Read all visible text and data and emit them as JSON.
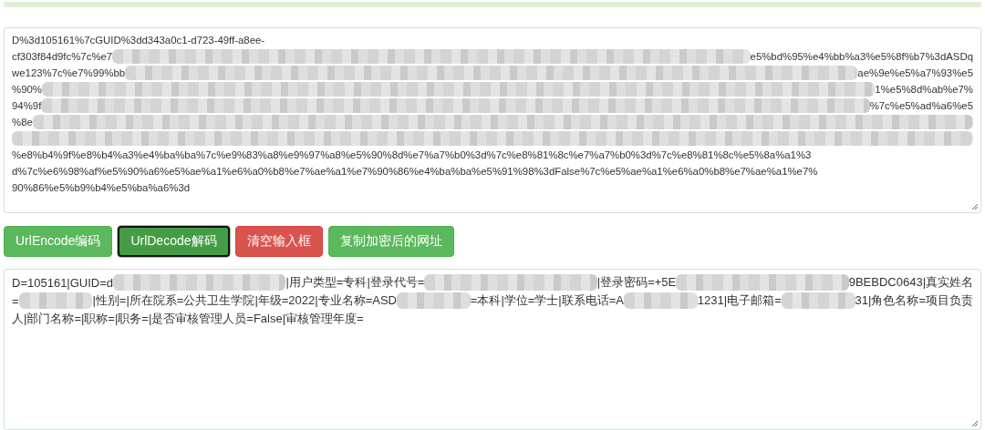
{
  "input_box": {
    "lines": [
      [
        {
          "kind": "text",
          "text": "D%3d105161%7cGUID%3dd343a0c1-d723-49ff-a8ee-"
        }
      ],
      [
        {
          "kind": "text",
          "text": "cf303f84d9fc%7c%e7"
        },
        {
          "kind": "redacted"
        },
        {
          "kind": "text",
          "text": "e5%bd%95%e4%bb%a3%e5%8f%b7%3dASDq"
        }
      ],
      [
        {
          "kind": "text",
          "text": "we123%7c%e7%99%bb"
        },
        {
          "kind": "redacted"
        },
        {
          "kind": "text",
          "text": "ae%9e%e5%a7%93%e5"
        }
      ],
      [
        {
          "kind": "text",
          "text": "%90%"
        },
        {
          "kind": "redacted"
        },
        {
          "kind": "text",
          "text": "1%e5%8d%ab%e7%"
        }
      ],
      [
        {
          "kind": "text",
          "text": "94%9f"
        },
        {
          "kind": "redacted"
        },
        {
          "kind": "text",
          "text": "%7c%e5%ad%a6%e5"
        }
      ],
      [
        {
          "kind": "text",
          "text": "%8e"
        },
        {
          "kind": "redacted"
        }
      ],
      [
        {
          "kind": "redacted"
        }
      ],
      [
        {
          "kind": "text",
          "text": "%e8%b4%9f%e8%b4%a3%e4%ba%ba%7c%e9%83%a8%e9%97%a8%e5%90%8d%e7%a7%b0%3d%7c%e8%81%8c%e7%a7%b0%3d%7c%e8%81%8c%e5%8a%a1%3"
        }
      ],
      [
        {
          "kind": "text",
          "text": "d%7c%e6%98%af%e5%90%a6%e5%ae%a1%e6%a0%b8%e7%ae%a1%e7%90%86%e4%ba%ba%e5%91%98%3dFalse%7c%e5%ae%a1%e6%a0%b8%e7%ae%a1%e7%"
        }
      ],
      [
        {
          "kind": "text",
          "text": "90%86%e5%b9%b4%e5%ba%a6%3d"
        }
      ]
    ]
  },
  "buttons": [
    {
      "label": "UrlEncode编码",
      "kind": "success",
      "focused": false
    },
    {
      "label": "UrlDecode解码",
      "kind": "success",
      "focused": true
    },
    {
      "label": "清空输入框",
      "kind": "danger",
      "focused": false
    },
    {
      "label": "复制加密后的网址",
      "kind": "success",
      "focused": false
    }
  ],
  "output_box": {
    "lines": [
      [
        {
          "kind": "text",
          "text": "D=105161|GUID=d"
        },
        {
          "kind": "redacted"
        },
        {
          "kind": "text",
          "text": "|用户类型=专科|登录代号="
        },
        {
          "kind": "redacted"
        },
        {
          "kind": "text",
          "text": "|登录密码=+5E"
        },
        {
          "kind": "redacted"
        },
        {
          "kind": "text",
          "text": "9BEBDC0643|真实姓名"
        }
      ],
      [
        {
          "kind": "text",
          "text": "="
        },
        {
          "kind": "redacted"
        },
        {
          "kind": "text",
          "text": "|性别=|所在院系=公共卫生学院|年级=2022|专业名称=ASD"
        },
        {
          "kind": "redacted"
        },
        {
          "kind": "text",
          "text": "=本科|学位=学士|联系电话=A"
        },
        {
          "kind": "redacted"
        },
        {
          "kind": "text",
          "text": "1231|电子邮箱="
        },
        {
          "kind": "redacted"
        },
        {
          "kind": "text",
          "text": "31|角色名称=项目负责"
        }
      ],
      [
        {
          "kind": "text",
          "text": "人|部门名称=|职称=|职务=|是否审核管理人员=False|审核管理年度="
        }
      ]
    ]
  }
}
